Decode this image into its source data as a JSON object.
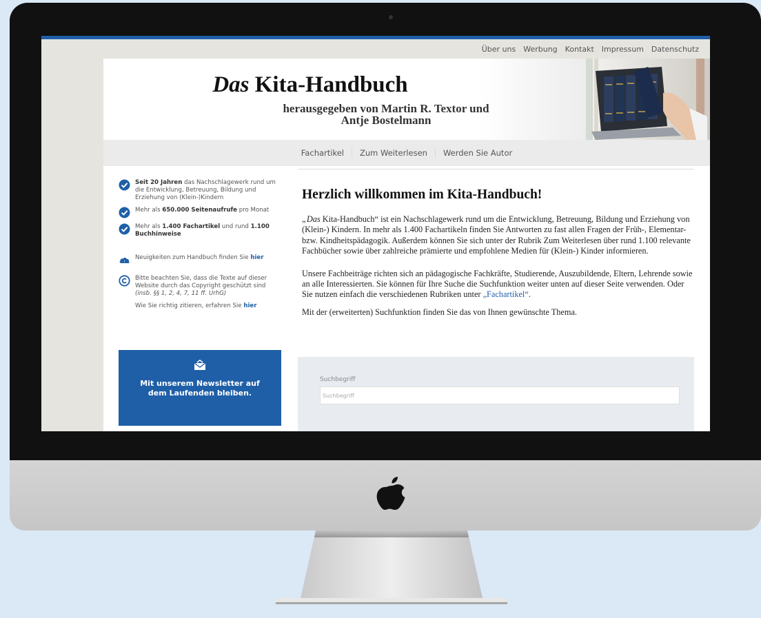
{
  "topnav": [
    "Über uns",
    "Werbung",
    "Kontakt",
    "Impressum",
    "Datenschutz"
  ],
  "header": {
    "title_em": "Das",
    "title_rest": " Kita-Handbuch",
    "subtitle_line1": "herausgegeben von Martin R. Textor und",
    "subtitle_line2": "Antje Bostelmann"
  },
  "mainnav": [
    "Fachartikel",
    "Zum Weiterlesen",
    "Werden Sie Autor"
  ],
  "sidebar": {
    "item1": {
      "bold": "Seit 20 Jahren",
      "text": " das Nachschlagewerk rund um die Entwicklung, Betreuung, Bildung und Erziehung von (Klein-)Kindern"
    },
    "item2": {
      "pre": "Mehr als ",
      "bold": "650.000 Seitenaufrufe",
      "post": " pro Monat"
    },
    "item3": {
      "pre": "Mehr als ",
      "bold": "1.400 Fachartikel",
      "mid": " und rund ",
      "bold2": "1.100 Buchhinweise"
    },
    "news": {
      "text": "Neuigkeiten zum Handbuch finden Sie ",
      "link": "hier"
    },
    "copyright": {
      "text": "Bitte beachten Sie, dass die Texte auf dieser Website durch das Copyright geschützt sind ",
      "ref": "(insb. §§ 1, 2, 4, 7, 11 ff. UrhG)"
    },
    "cite": {
      "text": "Wie Sie richtig zitieren, erfahren Sie ",
      "link": "hier"
    }
  },
  "newsletter": {
    "line1": "Mit unserem Newsletter auf",
    "line2": "dem Laufenden bleiben."
  },
  "content": {
    "welcome": "Herzlich willkommen im Kita-Handbuch!",
    "p1_em": "„Das",
    "p1": " Kita-Handbuch“ ist ein Nachschlagewerk rund um die Entwicklung, Betreuung, Bildung und Erziehung von (Klein-) Kindern. In mehr als 1.400 Fachartikeln finden Sie Antworten zu fast allen Fragen der Früh-, Elementar- bzw. Kindheitspädagogik. Außerdem können Sie sich unter der Rubrik Zum Weiterlesen über rund 1.100 relevante Fachbücher sowie über zahlreiche prämierte und empfohlene Medien für (Klein-) Kinder informieren.",
    "p2": "Unsere Fachbeiträge richten sich an pädagogische Fachkräfte, Studierende, Auszubildende, Eltern, Lehrende sowie an alle Interessierten. Sie können für Ihre Suche die Suchfunktion weiter unten auf dieser Seite verwenden. Oder Sie nutzen einfach die verschiedenen Rubriken unter ",
    "p2_link": "„Fachartikel“",
    "p2_end": ".",
    "p3": "Mit der (erweiterten) Suchfunktion finden Sie das von Ihnen gewünschte Thema."
  },
  "search": {
    "label": "Suchbegriff",
    "placeholder": "Suchbegriff"
  },
  "colors": {
    "accent": "#1f5fa8",
    "screen_bg": "#e5e4df",
    "backdrop": "#dbe8f6"
  }
}
